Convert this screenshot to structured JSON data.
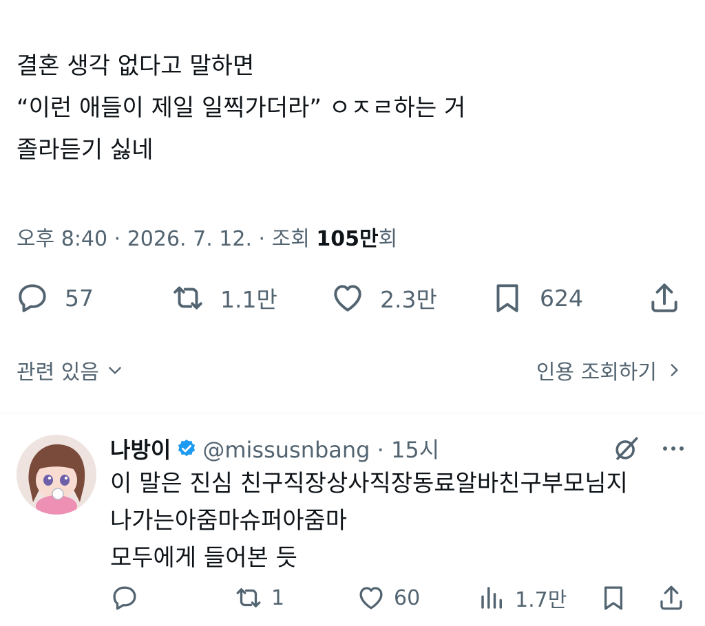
{
  "tweet": {
    "lines": [
      "결혼 생각 없다고 말하면",
      "“이런 애들이 제일 일찍가더라” ㅇㅈㄹ하는 거",
      "졸라듣기 싫네"
    ],
    "time": "오후 8:40 · 2026. 7. 12. · 조회 ",
    "views_count": "105만",
    "views_suffix": "회"
  },
  "actions": {
    "replies": "57",
    "retweets": "1.1만",
    "likes": "2.3만",
    "bookmarks": "624"
  },
  "related": {
    "label": "관련 있음",
    "quotes_label": "인용 조회하기"
  },
  "reply": {
    "name": "나방이",
    "handle": "@missusnbang · 15시",
    "lines": [
      "이 말은 진심 친구직장상사직장동료알바친구부모님지",
      "나가는아줌마슈퍼아줌마",
      "모두에게 들어본 듯"
    ],
    "retweets": "1",
    "likes": "60",
    "views": "1.7만"
  },
  "colors": {
    "text": "#0f1419",
    "secondary": "#536471",
    "verified": "#1d9bf0"
  }
}
